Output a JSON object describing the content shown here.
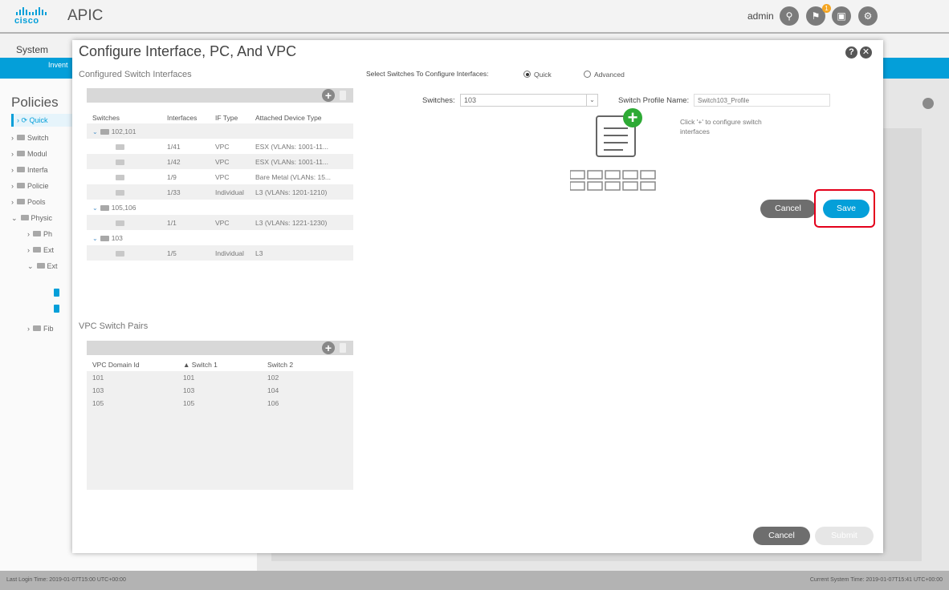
{
  "header": {
    "logo_text": "cisco",
    "app_name": "APIC",
    "user": "admin",
    "notification_count": "1"
  },
  "nav": {
    "system": "System",
    "subnav": "Invent"
  },
  "left_pane": {
    "title": "Policies",
    "items": [
      "Quick",
      "Switch",
      "Modul",
      "Interfa",
      "Policie",
      "Pools",
      "Physic",
      "Ph",
      "Ext",
      "Ext",
      "Fib"
    ]
  },
  "footer": {
    "last_login": "Last Login Time: 2019-01-07T15:00 UTC+00:00",
    "current_time": "Current System Time: 2019-01-07T15:41 UTC+00:00"
  },
  "modal": {
    "title": "Configure Interface, PC, And VPC",
    "configured_label": "Configured Switch Interfaces",
    "interfaces_table": {
      "columns": [
        "Switches",
        "Interfaces",
        "IF Type",
        "Attached Device Type"
      ],
      "groups": [
        {
          "name": "102,101",
          "rows": [
            {
              "interface": "1/41",
              "type": "VPC",
              "device": "ESX (VLANs: 1001-11..."
            },
            {
              "interface": "1/42",
              "type": "VPC",
              "device": "ESX (VLANs: 1001-11..."
            },
            {
              "interface": "1/9",
              "type": "VPC",
              "device": "Bare Metal (VLANs: 15..."
            },
            {
              "interface": "1/33",
              "type": "Individual",
              "device": "L3 (VLANs: 1201-1210)"
            }
          ]
        },
        {
          "name": "105,106",
          "rows": [
            {
              "interface": "1/1",
              "type": "VPC",
              "device": "L3 (VLANs: 1221-1230)"
            }
          ]
        },
        {
          "name": "103",
          "rows": [
            {
              "interface": "1/5",
              "type": "Individual",
              "device": "L3"
            }
          ]
        }
      ]
    },
    "vpc_label": "VPC Switch Pairs",
    "vpc_table": {
      "columns": [
        "VPC Domain Id",
        "Switch 1",
        "Switch 2"
      ],
      "rows": [
        [
          "101",
          "101",
          "102"
        ],
        [
          "103",
          "103",
          "104"
        ],
        [
          "105",
          "105",
          "106"
        ]
      ]
    },
    "select_label": "Select Switches To Configure Interfaces:",
    "radio_quick": "Quick",
    "radio_advanced": "Advanced",
    "switches_label": "Switches:",
    "switches_value": "103",
    "profile_label": "Switch Profile Name:",
    "profile_placeholder": "Switch103_Profile",
    "hint": "Click '+' to configure switch interfaces",
    "cancel": "Cancel",
    "save": "Save",
    "cancel_bottom": "Cancel",
    "submit": "Submit"
  },
  "colors": {
    "accent": "#049fd9",
    "highlight": "#e3001b",
    "add_green": "#2eaa35"
  }
}
